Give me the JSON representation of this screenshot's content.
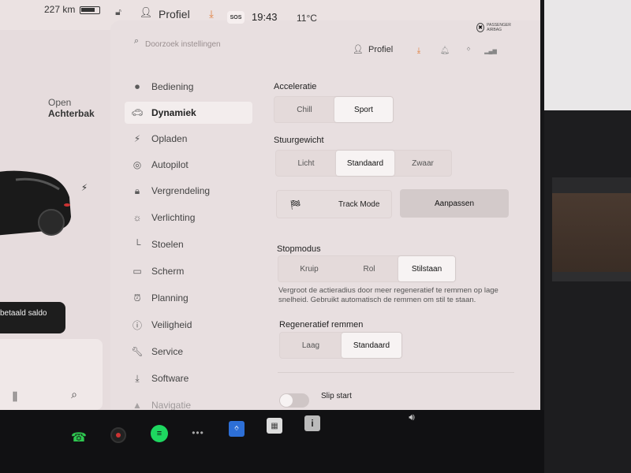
{
  "status": {
    "range": "227 km",
    "battery_level": 0.75,
    "profile_label": "Profiel",
    "sos": "SOS",
    "clock": "19:43",
    "temperature": "11°C",
    "airbag": "PASSENGER AIRBAG"
  },
  "left_panel": {
    "open_label": "Open",
    "trunk_label": "Achterbak",
    "balance_text": "betaald saldo"
  },
  "header": {
    "search_placeholder": "Doorzoek instellingen",
    "profile_label": "Profiel"
  },
  "menu": [
    {
      "label": "Bediening",
      "icon": "toggle-icon"
    },
    {
      "label": "Dynamiek",
      "icon": "car-icon"
    },
    {
      "label": "Opladen",
      "icon": "bolt-icon"
    },
    {
      "label": "Autopilot",
      "icon": "steering-wheel-icon"
    },
    {
      "label": "Vergrendeling",
      "icon": "lock-icon"
    },
    {
      "label": "Verlichting",
      "icon": "light-icon"
    },
    {
      "label": "Stoelen",
      "icon": "seat-icon"
    },
    {
      "label": "Scherm",
      "icon": "screen-icon"
    },
    {
      "label": "Planning",
      "icon": "alarm-clock-icon"
    },
    {
      "label": "Veiligheid",
      "icon": "safety-icon"
    },
    {
      "label": "Service",
      "icon": "wrench-icon"
    },
    {
      "label": "Software",
      "icon": "download-icon"
    },
    {
      "label": "Navigatie",
      "icon": "navigation-icon"
    }
  ],
  "active_menu": "Dynamiek",
  "acceleration": {
    "title": "Acceleratie",
    "options": [
      "Chill",
      "Sport"
    ],
    "selected": "Sport"
  },
  "steering": {
    "title": "Stuurgewicht",
    "options": [
      "Licht",
      "Standaard",
      "Zwaar"
    ],
    "selected": "Standaard"
  },
  "track_mode": {
    "label": "Track Mode",
    "adjust_label": "Aanpassen"
  },
  "stop_mode": {
    "title": "Stopmodus",
    "options": [
      "Kruip",
      "Rol",
      "Stilstaan"
    ],
    "selected": "Stilstaan",
    "description": "Vergroot de actieradius door meer regeneratief te remmen op lage snelheid. Gebruikt automatisch de remmen om stil te staan."
  },
  "regen": {
    "title": "Regeneratief remmen",
    "options": [
      "Laag",
      "Standaard"
    ],
    "selected": "Standaard"
  },
  "slip_start": {
    "label": "Slip start",
    "enabled": false
  },
  "colors": {
    "accent_orange": "#e07a36",
    "spotify_green": "#1ed760",
    "phone_green": "#2ec850",
    "bluetooth_blue": "#2d6fd6"
  }
}
